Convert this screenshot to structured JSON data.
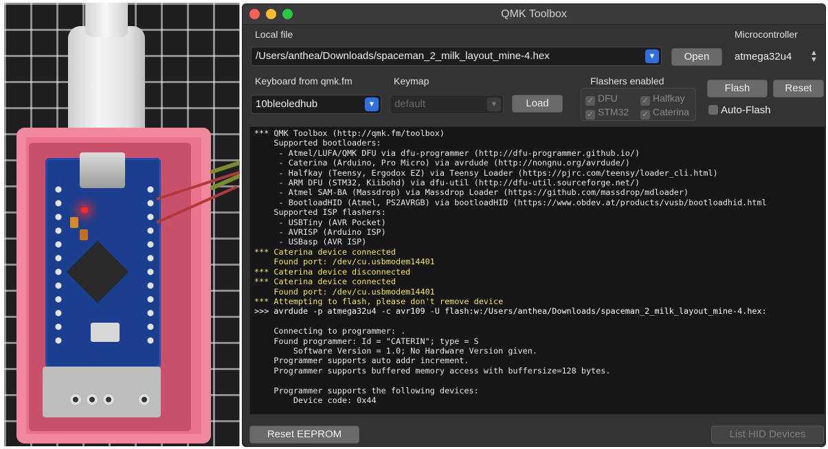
{
  "window": {
    "title": "QMK Toolbox"
  },
  "local_file": {
    "label": "Local file",
    "value": "/Users/anthea/Downloads/spaceman_2_milk_layout_mine-4.hex",
    "open_label": "Open"
  },
  "microcontroller": {
    "label": "Microcontroller",
    "value": "atmega32u4"
  },
  "keyboard": {
    "label": "Keyboard from qmk.fm",
    "value": "10bleoledhub"
  },
  "keymap": {
    "label": "Keymap",
    "value": "default",
    "load_label": "Load"
  },
  "flashers": {
    "label": "Flashers enabled",
    "items": [
      "DFU",
      "Halfkay",
      "STM32",
      "Caterina"
    ]
  },
  "actions": {
    "flash_label": "Flash",
    "reset_label": "Reset",
    "autoflash_label": "Auto-Flash",
    "reset_eeprom_label": "Reset EEPROM",
    "list_hid_label": "List HID Devices"
  },
  "colors": {
    "console_bg": "#161618",
    "highlight": "#f2e44a",
    "accent": "#2f6fe0"
  },
  "console": {
    "lines": [
      {
        "text": "*** QMK Toolbox (http://qmk.fm/toolbox)",
        "kind": "normal"
      },
      {
        "text": "    Supported bootloaders:",
        "kind": "normal"
      },
      {
        "text": "     - Atmel/LUFA/QMK DFU via dfu-programmer (http://dfu-programmer.github.io/)",
        "kind": "normal"
      },
      {
        "text": "     - Caterina (Arduino, Pro Micro) via avrdude (http://nongnu.org/avrdude/)",
        "kind": "normal"
      },
      {
        "text": "     - Halfkay (Teensy, Ergodox EZ) via Teensy Loader (https://pjrc.com/teensy/loader_cli.html)",
        "kind": "normal"
      },
      {
        "text": "     - ARM DFU (STM32, Kiibohd) via dfu-util (http://dfu-util.sourceforge.net/)",
        "kind": "normal"
      },
      {
        "text": "     - Atmel SAM-BA (Massdrop) via Massdrop Loader (https://github.com/massdrop/mdloader)",
        "kind": "normal"
      },
      {
        "text": "     - BootloadHID (Atmel, PS2AVRGB) via bootloadHID (https://www.obdev.at/products/vusb/bootloadhid.html",
        "kind": "normal"
      },
      {
        "text": "    Supported ISP flashers:",
        "kind": "normal"
      },
      {
        "text": "     - USBTiny (AVR Pocket)",
        "kind": "normal"
      },
      {
        "text": "     - AVRISP (Arduino ISP)",
        "kind": "normal"
      },
      {
        "text": "     - USBasp (AVR ISP)",
        "kind": "normal"
      },
      {
        "text": "*** Caterina device connected",
        "kind": "hl"
      },
      {
        "text": "    Found port: /dev/cu.usbmodem14401",
        "kind": "hl"
      },
      {
        "text": "*** Caterina device disconnected",
        "kind": "hl"
      },
      {
        "text": "*** Caterina device connected",
        "kind": "hl"
      },
      {
        "text": "    Found port: /dev/cu.usbmodem14401",
        "kind": "hl"
      },
      {
        "text": "*** Attempting to flash, please don't remove device",
        "kind": "hl"
      },
      {
        "text": ">>> avrdude -p atmega32u4 -c avr109 -U flash:w:/Users/anthea/Downloads/spaceman_2_milk_layout_mine-4.hex:",
        "kind": "cmd"
      },
      {
        "text": "",
        "kind": "normal"
      },
      {
        "text": "    Connecting to programmer: .",
        "kind": "normal"
      },
      {
        "text": "    Found programmer: Id = \"CATERIN\"; type = S",
        "kind": "normal"
      },
      {
        "text": "        Software Version = 1.0; No Hardware Version given.",
        "kind": "normal"
      },
      {
        "text": "    Programmer supports auto addr increment.",
        "kind": "normal"
      },
      {
        "text": "    Programmer supports buffered memory access with buffersize=128 bytes.",
        "kind": "normal"
      },
      {
        "text": "",
        "kind": "normal"
      },
      {
        "text": "    Programmer supports the following devices:",
        "kind": "normal"
      },
      {
        "text": "        Device code: 0x44",
        "kind": "normal"
      }
    ]
  }
}
